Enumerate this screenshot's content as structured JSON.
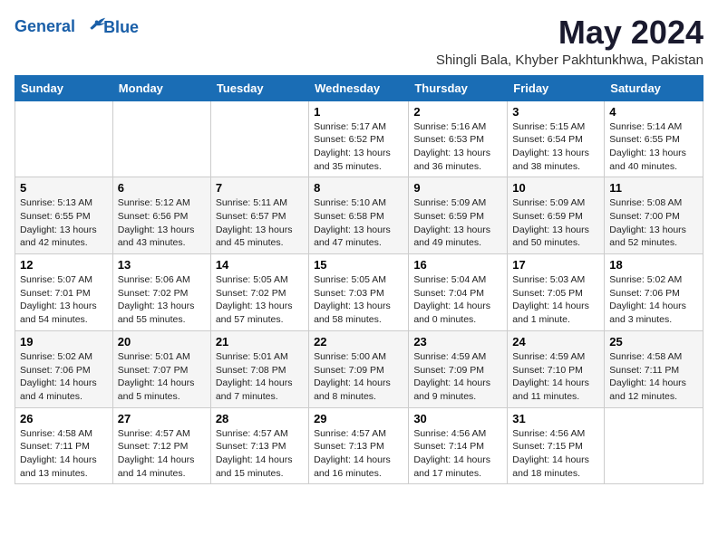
{
  "logo": {
    "line1": "General",
    "line2": "Blue"
  },
  "title": "May 2024",
  "subtitle": "Shingli Bala, Khyber Pakhtunkhwa, Pakistan",
  "days_of_week": [
    "Sunday",
    "Monday",
    "Tuesday",
    "Wednesday",
    "Thursday",
    "Friday",
    "Saturday"
  ],
  "weeks": [
    [
      {
        "day": "",
        "info": ""
      },
      {
        "day": "",
        "info": ""
      },
      {
        "day": "",
        "info": ""
      },
      {
        "day": "1",
        "info": "Sunrise: 5:17 AM\nSunset: 6:52 PM\nDaylight: 13 hours\nand 35 minutes."
      },
      {
        "day": "2",
        "info": "Sunrise: 5:16 AM\nSunset: 6:53 PM\nDaylight: 13 hours\nand 36 minutes."
      },
      {
        "day": "3",
        "info": "Sunrise: 5:15 AM\nSunset: 6:54 PM\nDaylight: 13 hours\nand 38 minutes."
      },
      {
        "day": "4",
        "info": "Sunrise: 5:14 AM\nSunset: 6:55 PM\nDaylight: 13 hours\nand 40 minutes."
      }
    ],
    [
      {
        "day": "5",
        "info": "Sunrise: 5:13 AM\nSunset: 6:55 PM\nDaylight: 13 hours\nand 42 minutes."
      },
      {
        "day": "6",
        "info": "Sunrise: 5:12 AM\nSunset: 6:56 PM\nDaylight: 13 hours\nand 43 minutes."
      },
      {
        "day": "7",
        "info": "Sunrise: 5:11 AM\nSunset: 6:57 PM\nDaylight: 13 hours\nand 45 minutes."
      },
      {
        "day": "8",
        "info": "Sunrise: 5:10 AM\nSunset: 6:58 PM\nDaylight: 13 hours\nand 47 minutes."
      },
      {
        "day": "9",
        "info": "Sunrise: 5:09 AM\nSunset: 6:59 PM\nDaylight: 13 hours\nand 49 minutes."
      },
      {
        "day": "10",
        "info": "Sunrise: 5:09 AM\nSunset: 6:59 PM\nDaylight: 13 hours\nand 50 minutes."
      },
      {
        "day": "11",
        "info": "Sunrise: 5:08 AM\nSunset: 7:00 PM\nDaylight: 13 hours\nand 52 minutes."
      }
    ],
    [
      {
        "day": "12",
        "info": "Sunrise: 5:07 AM\nSunset: 7:01 PM\nDaylight: 13 hours\nand 54 minutes."
      },
      {
        "day": "13",
        "info": "Sunrise: 5:06 AM\nSunset: 7:02 PM\nDaylight: 13 hours\nand 55 minutes."
      },
      {
        "day": "14",
        "info": "Sunrise: 5:05 AM\nSunset: 7:02 PM\nDaylight: 13 hours\nand 57 minutes."
      },
      {
        "day": "15",
        "info": "Sunrise: 5:05 AM\nSunset: 7:03 PM\nDaylight: 13 hours\nand 58 minutes."
      },
      {
        "day": "16",
        "info": "Sunrise: 5:04 AM\nSunset: 7:04 PM\nDaylight: 14 hours\nand 0 minutes."
      },
      {
        "day": "17",
        "info": "Sunrise: 5:03 AM\nSunset: 7:05 PM\nDaylight: 14 hours\nand 1 minute."
      },
      {
        "day": "18",
        "info": "Sunrise: 5:02 AM\nSunset: 7:06 PM\nDaylight: 14 hours\nand 3 minutes."
      }
    ],
    [
      {
        "day": "19",
        "info": "Sunrise: 5:02 AM\nSunset: 7:06 PM\nDaylight: 14 hours\nand 4 minutes."
      },
      {
        "day": "20",
        "info": "Sunrise: 5:01 AM\nSunset: 7:07 PM\nDaylight: 14 hours\nand 5 minutes."
      },
      {
        "day": "21",
        "info": "Sunrise: 5:01 AM\nSunset: 7:08 PM\nDaylight: 14 hours\nand 7 minutes."
      },
      {
        "day": "22",
        "info": "Sunrise: 5:00 AM\nSunset: 7:09 PM\nDaylight: 14 hours\nand 8 minutes."
      },
      {
        "day": "23",
        "info": "Sunrise: 4:59 AM\nSunset: 7:09 PM\nDaylight: 14 hours\nand 9 minutes."
      },
      {
        "day": "24",
        "info": "Sunrise: 4:59 AM\nSunset: 7:10 PM\nDaylight: 14 hours\nand 11 minutes."
      },
      {
        "day": "25",
        "info": "Sunrise: 4:58 AM\nSunset: 7:11 PM\nDaylight: 14 hours\nand 12 minutes."
      }
    ],
    [
      {
        "day": "26",
        "info": "Sunrise: 4:58 AM\nSunset: 7:11 PM\nDaylight: 14 hours\nand 13 minutes."
      },
      {
        "day": "27",
        "info": "Sunrise: 4:57 AM\nSunset: 7:12 PM\nDaylight: 14 hours\nand 14 minutes."
      },
      {
        "day": "28",
        "info": "Sunrise: 4:57 AM\nSunset: 7:13 PM\nDaylight: 14 hours\nand 15 minutes."
      },
      {
        "day": "29",
        "info": "Sunrise: 4:57 AM\nSunset: 7:13 PM\nDaylight: 14 hours\nand 16 minutes."
      },
      {
        "day": "30",
        "info": "Sunrise: 4:56 AM\nSunset: 7:14 PM\nDaylight: 14 hours\nand 17 minutes."
      },
      {
        "day": "31",
        "info": "Sunrise: 4:56 AM\nSunset: 7:15 PM\nDaylight: 14 hours\nand 18 minutes."
      },
      {
        "day": "",
        "info": ""
      }
    ]
  ]
}
